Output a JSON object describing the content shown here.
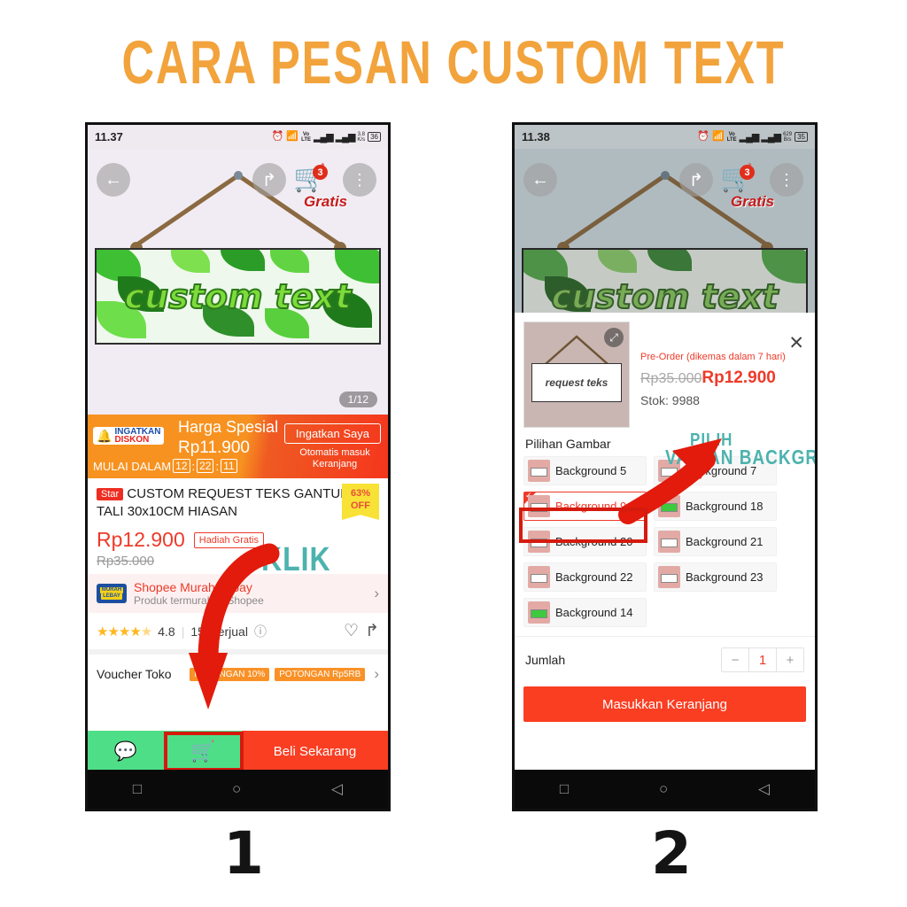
{
  "page": {
    "title": "CARA PESAN CUSTOM TEXT",
    "step1_number": "1",
    "step2_number": "2"
  },
  "phone1": {
    "status": {
      "time": "11.37",
      "alarm_icon": "alarm-icon",
      "wifi_icon": "wifi-icon",
      "network": "Vo LTE",
      "data_rate": "3.8 K/s",
      "battery": "36"
    },
    "image": {
      "sign_text": "custom text",
      "back_icon": "back-arrow-icon",
      "share_icon": "share-icon",
      "cart_icon": "cart-icon",
      "cart_badge": "3",
      "gratis_label": "Gratis",
      "menu_icon": "more-vertical-icon",
      "page_indicator": "1/12"
    },
    "promo": {
      "logo_line1": "INGATKAN",
      "logo_line2": "DISKON",
      "headline": "Harga Spesial",
      "price": "Rp11.900",
      "countdown_label": "MULAI DALAM",
      "cd_hours": "12",
      "cd_minutes": "22",
      "cd_seconds": "11",
      "button": "Ingatkan Saya",
      "button_sub": "Otomatis masuk Keranjang"
    },
    "product": {
      "star_tag": "Star",
      "title": "CUSTOM REQUEST TEKS GANTUNGAN TALI 30x10CM HIASAN",
      "discount_pct": "63%",
      "discount_off": "OFF",
      "price_now": "Rp12.900",
      "gift_tag": "Hadiah Gratis",
      "price_old": "Rp35.000"
    },
    "shop": {
      "logo_line1": "MURAH",
      "logo_line2": "LEBAY",
      "name": "Shopee Murah Lebay",
      "subtitle": "Produk termurah di Shopee",
      "chevron_icon": "chevron-right-icon"
    },
    "rating": {
      "stars": "★★★★",
      "half_star": "☆",
      "value": "4.8",
      "sold": "15x terjual",
      "info_icon": "info-icon",
      "heart_icon": "heart-icon",
      "share_icon": "share-icon"
    },
    "voucher": {
      "label": "Voucher Toko",
      "tag1": "POTONGAN 10%",
      "tag2": "POTONGAN Rp5RB",
      "chevron_icon": "chevron-right-icon"
    },
    "actions": {
      "chat_icon": "chat-icon",
      "cart_icon": "add-to-cart-icon",
      "buy_label": "Beli Sekarang"
    },
    "nav": {
      "recents_icon": "square-recents-icon",
      "home_icon": "circle-home-icon",
      "back_icon": "triangle-back-icon"
    },
    "annotation": {
      "klik_text": "KLIK",
      "arrow_color": "#e21b0c",
      "highlight_color": "#d51a0e"
    }
  },
  "phone2": {
    "status": {
      "time": "11.38",
      "alarm_icon": "alarm-icon",
      "wifi_icon": "wifi-icon",
      "network": "Vo LTE",
      "data_rate": "629 B/s",
      "battery": "35"
    },
    "image": {
      "sign_text": "custom text",
      "back_icon": "back-arrow-icon",
      "share_icon": "share-icon",
      "cart_icon": "cart-icon",
      "cart_badge": "3",
      "gratis_label": "Gratis",
      "menu_icon": "more-vertical-icon"
    },
    "modal": {
      "thumb_text": "request teks",
      "expand_icon": "expand-icon",
      "close_icon": "close-icon",
      "preorder": "Pre-Order (dikemas dalam 7 hari)",
      "price_old": "Rp35.000",
      "price_new": "Rp12.900",
      "stock": "Stok: 9988",
      "variant_header": "Pilihan Gambar",
      "variants": [
        {
          "label": "Background 5",
          "selected": false,
          "green": false
        },
        {
          "label": "Background 7",
          "selected": false,
          "green": false
        },
        {
          "label": "Background 9",
          "selected": true,
          "green": false
        },
        {
          "label": "Background 18",
          "selected": false,
          "green": true
        },
        {
          "label": "Background 20",
          "selected": false,
          "green": false
        },
        {
          "label": "Background 21",
          "selected": false,
          "green": false
        },
        {
          "label": "Background 22",
          "selected": false,
          "green": false
        },
        {
          "label": "Background 23",
          "selected": false,
          "green": false
        },
        {
          "label": "Background 14",
          "selected": false,
          "green": true
        }
      ],
      "qty_label": "Jumlah",
      "qty_minus": "−",
      "qty_value": "1",
      "qty_plus": "+",
      "add_cart_label": "Masukkan Keranjang"
    },
    "nav": {
      "recents_icon": "square-recents-icon",
      "home_icon": "circle-home-icon",
      "back_icon": "triangle-back-icon"
    },
    "annotation": {
      "line1": "PILIH",
      "line2": "VARIAN BACKGROUND",
      "arrow_color": "#e21b0c",
      "highlight_color": "#d51a0e"
    }
  },
  "colors": {
    "title_orange": "#f2a33c",
    "shopee_red": "#ee3a29",
    "promo_orange": "#f79220",
    "green_action": "#4fde88",
    "annotation_teal": "#4cb3ae",
    "annotation_red": "#e21b0c"
  }
}
